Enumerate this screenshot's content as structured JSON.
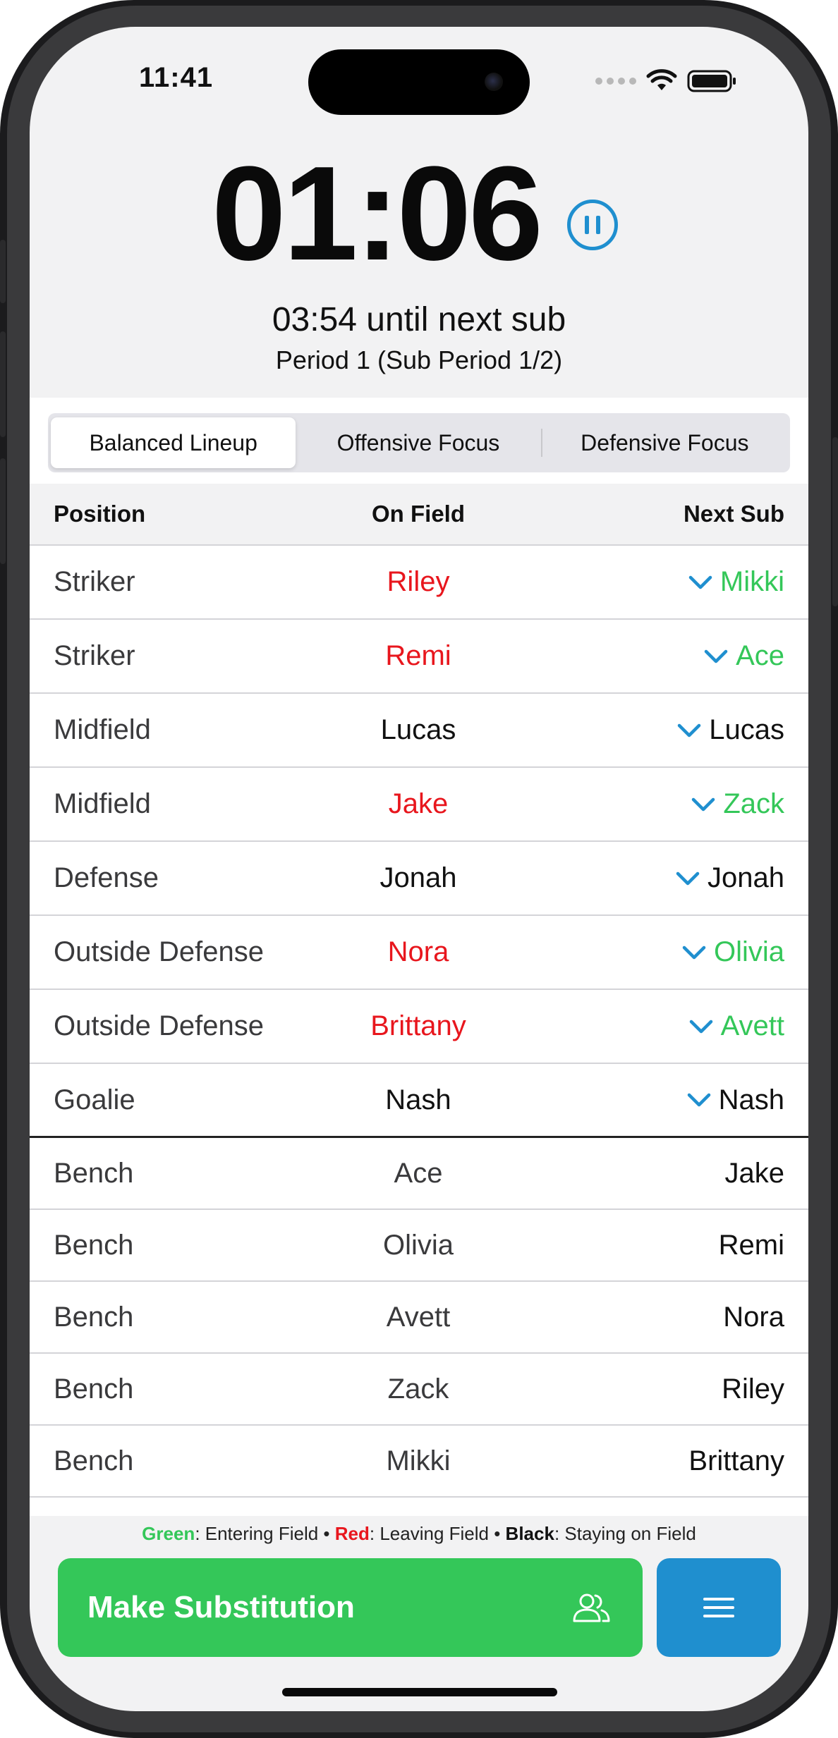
{
  "status_bar": {
    "time": "11:41"
  },
  "timer": {
    "elapsed": "01:06",
    "next_sub_text": "03:54 until next sub",
    "period_text": "Period 1 (Sub Period 1/2)"
  },
  "lineup_tabs": [
    {
      "label": "Balanced Lineup",
      "active": true
    },
    {
      "label": "Offensive Focus",
      "active": false
    },
    {
      "label": "Defensive Focus",
      "active": false
    }
  ],
  "table": {
    "headers": {
      "position": "Position",
      "on_field": "On Field",
      "next_sub": "Next Sub"
    },
    "field_rows": [
      {
        "position": "Striker",
        "on_field": "Riley",
        "on_field_status": "leaving",
        "next_sub": "Mikki",
        "next_sub_status": "entering"
      },
      {
        "position": "Striker",
        "on_field": "Remi",
        "on_field_status": "leaving",
        "next_sub": "Ace",
        "next_sub_status": "entering"
      },
      {
        "position": "Midfield",
        "on_field": "Lucas",
        "on_field_status": "staying",
        "next_sub": "Lucas",
        "next_sub_status": "staying"
      },
      {
        "position": "Midfield",
        "on_field": "Jake",
        "on_field_status": "leaving",
        "next_sub": "Zack",
        "next_sub_status": "entering"
      },
      {
        "position": "Defense",
        "on_field": "Jonah",
        "on_field_status": "staying",
        "next_sub": "Jonah",
        "next_sub_status": "staying"
      },
      {
        "position": "Outside Defense",
        "on_field": "Nora",
        "on_field_status": "leaving",
        "next_sub": "Olivia",
        "next_sub_status": "entering"
      },
      {
        "position": "Outside Defense",
        "on_field": "Brittany",
        "on_field_status": "leaving",
        "next_sub": "Avett",
        "next_sub_status": "entering"
      },
      {
        "position": "Goalie",
        "on_field": "Nash",
        "on_field_status": "staying",
        "next_sub": "Nash",
        "next_sub_status": "staying"
      }
    ],
    "bench_rows": [
      {
        "position": "Bench",
        "on_field": "Ace",
        "next_sub": "Jake"
      },
      {
        "position": "Bench",
        "on_field": "Olivia",
        "next_sub": "Remi"
      },
      {
        "position": "Bench",
        "on_field": "Avett",
        "next_sub": "Nora"
      },
      {
        "position": "Bench",
        "on_field": "Zack",
        "next_sub": "Riley"
      },
      {
        "position": "Bench",
        "on_field": "Mikki",
        "next_sub": "Brittany"
      }
    ]
  },
  "legend": {
    "green_label": "Green",
    "green_text": ": Entering Field",
    "separator": " • ",
    "red_label": "Red",
    "red_text": ": Leaving Field",
    "black_label": "Black",
    "black_text": ": Staying on Field"
  },
  "actions": {
    "make_substitution_label": "Make Substitution"
  },
  "icons": {
    "pause": "pause-circle-icon",
    "chevron": "chevron-down-icon",
    "people": "people-icon",
    "menu": "menu-icon"
  },
  "colors": {
    "entering": "#34c759",
    "leaving": "#e8161d",
    "staying": "#111111",
    "accent_blue": "#1f8fcf",
    "button_green": "#34c759"
  }
}
